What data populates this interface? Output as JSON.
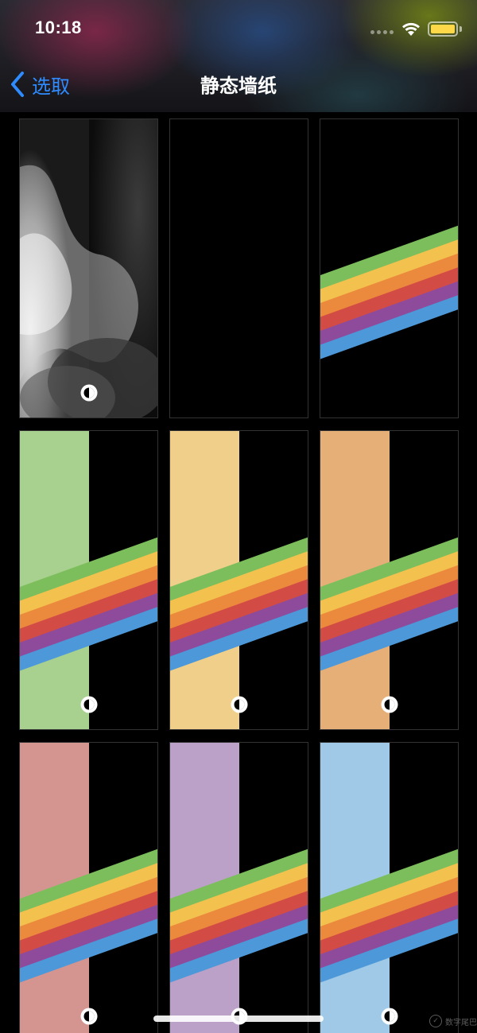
{
  "status_bar": {
    "time": "10:18",
    "battery_color": "#ffd84a"
  },
  "nav": {
    "back_label": "选取",
    "title": "静态墙纸",
    "accent": "#2f8cff"
  },
  "wallpapers": [
    {
      "name": "grayscale-abstract",
      "background": "#000000"
    },
    {
      "name": "black",
      "background": "#000000"
    },
    {
      "name": "rainbow-on-black",
      "background": "#000000"
    },
    {
      "name": "rainbow-green",
      "background": "#a8d190"
    },
    {
      "name": "rainbow-yellow",
      "background": "#f0cf8a"
    },
    {
      "name": "rainbow-orange",
      "background": "#e6af78"
    },
    {
      "name": "rainbow-pink",
      "background": "#d49591"
    },
    {
      "name": "rainbow-purple",
      "background": "#bba0c8"
    },
    {
      "name": "rainbow-blue",
      "background": "#9fc9e6"
    }
  ],
  "rainbow_colors": [
    "#7dbe5c",
    "#f2c14e",
    "#eb8a3c",
    "#d24c45",
    "#8e4b9c",
    "#4d98d8"
  ],
  "watermark": {
    "text": "数字尾巴",
    "logo": "tail-logo-icon"
  }
}
